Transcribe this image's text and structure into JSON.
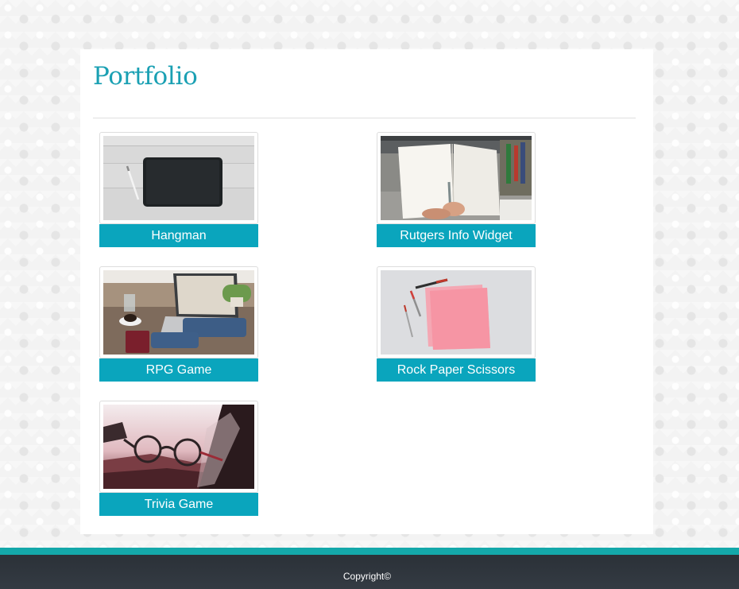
{
  "page": {
    "title": "Portfolio"
  },
  "portfolio": {
    "items": [
      {
        "label": "Hangman",
        "image": "tablet-on-wood-desk-photo"
      },
      {
        "label": "Rutgers Info Widget",
        "image": "open-notebook-with-pen-photo"
      },
      {
        "label": "RPG Game",
        "image": "laptop-typing-coffee-photo"
      },
      {
        "label": "Rock Paper Scissors",
        "image": "pink-notepad-with-pens-photo"
      },
      {
        "label": "Trivia Game",
        "image": "eyeglasses-sunset-photo"
      }
    ]
  },
  "footer": {
    "copyright": "Copyright©"
  },
  "colors": {
    "accent": "#1aa0b3",
    "button": "#0aa5bd",
    "footer_stripe": "#14a8aa",
    "footer_bg": "#2f363d"
  }
}
